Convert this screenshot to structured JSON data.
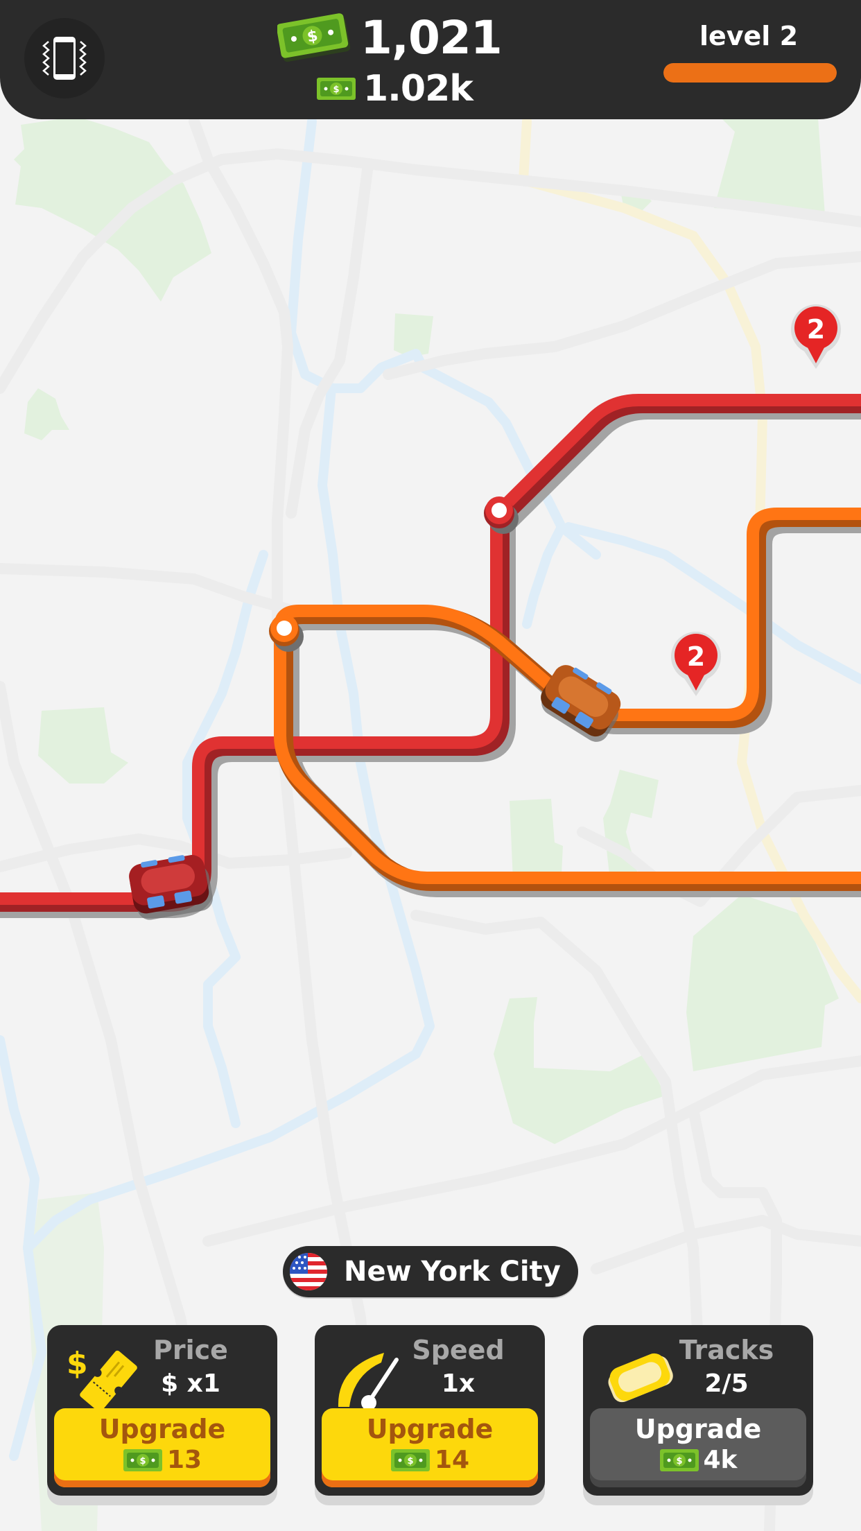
{
  "header": {
    "vibration_icon": "phone-vibrate-icon",
    "money_total": "1,021",
    "money_rate": "1.02k",
    "money_icon": "cash-bill-icon",
    "level_label": "level 2",
    "level_progress": 1.0
  },
  "map": {
    "lines": [
      {
        "name": "red-line",
        "color": "#e03232"
      },
      {
        "name": "orange-line",
        "color": "#ff7514"
      }
    ],
    "stations": [
      {
        "line": "red-line",
        "type": "station"
      },
      {
        "line": "orange-line",
        "type": "station"
      }
    ],
    "pins": [
      {
        "label": "2",
        "color": "#e52525"
      },
      {
        "label": "2",
        "color": "#e52525"
      }
    ],
    "trains": [
      {
        "line": "red-line",
        "color": "#b7282a"
      },
      {
        "line": "orange-line",
        "color": "#c8601e"
      }
    ]
  },
  "city": {
    "name": "New York City",
    "flag_icon": "usa-flag-icon"
  },
  "upgrades": [
    {
      "id": "price",
      "icon": "ticket-dollar-icon",
      "title": "Price",
      "value": "$ x1",
      "button_label": "Upgrade",
      "cost": "13",
      "enabled": true
    },
    {
      "id": "speed",
      "icon": "speedometer-icon",
      "title": "Speed",
      "value": "1x",
      "button_label": "Upgrade",
      "cost": "14",
      "enabled": true
    },
    {
      "id": "tracks",
      "icon": "track-piece-icon",
      "title": "Tracks",
      "value": "2/5",
      "button_label": "Upgrade",
      "cost": "4k",
      "enabled": false
    }
  ]
}
